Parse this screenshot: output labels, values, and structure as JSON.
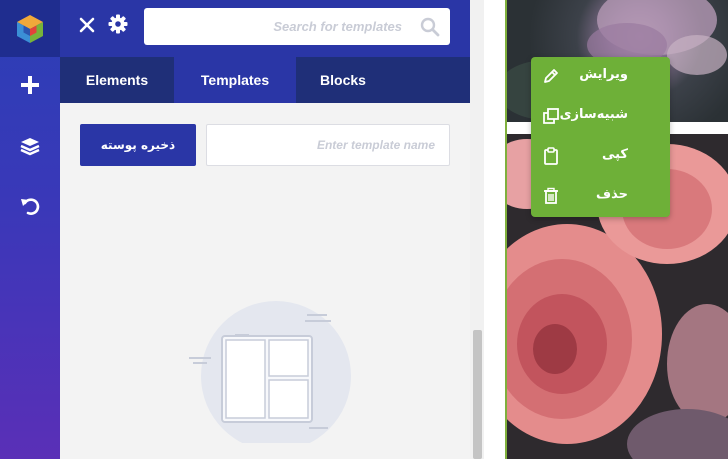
{
  "header": {
    "search_placeholder": "Search for templates",
    "icons": {
      "close": "close-icon",
      "settings": "gear-icon",
      "search": "search-icon"
    }
  },
  "rail": {
    "icons": [
      "logo-icon",
      "plus-icon",
      "layers-icon",
      "undo-icon"
    ]
  },
  "tabs": [
    {
      "label": "Elements",
      "active": false
    },
    {
      "label": "Templates",
      "active": true
    },
    {
      "label": "Blocks",
      "active": false
    }
  ],
  "templates": {
    "save_label": "ذخیره پوسته",
    "name_placeholder": "Enter template name"
  },
  "context_menu": {
    "items": [
      {
        "label": "ویرایش",
        "icon": "pencil-icon"
      },
      {
        "label": "شبیه‌سازی",
        "icon": "duplicate-icon"
      },
      {
        "label": "کپی",
        "icon": "clipboard-icon"
      },
      {
        "label": "حذف",
        "icon": "trash-icon"
      }
    ]
  },
  "colors": {
    "brand_blue": "#2a36a6",
    "tabs_bg": "#1f2f78",
    "menu_green": "#6eb038"
  }
}
